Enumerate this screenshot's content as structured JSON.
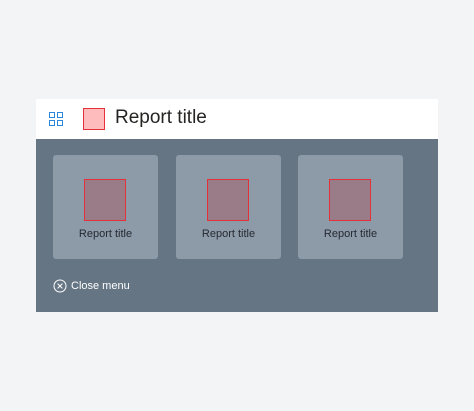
{
  "header": {
    "title": "Report title",
    "menu_icon": "grid-icon",
    "thumbnail_color": "#ffbcbc",
    "thumbnail_border_color": "#e5313a"
  },
  "menu": {
    "background_color": "#657584",
    "cards": [
      {
        "label": "Report title"
      },
      {
        "label": "Report title"
      },
      {
        "label": "Report title"
      }
    ],
    "close": {
      "label": "Close menu",
      "icon": "close-circle-icon"
    }
  }
}
